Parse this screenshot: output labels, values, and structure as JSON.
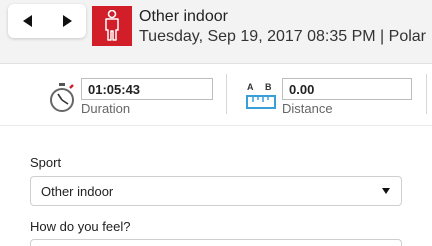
{
  "nav": {
    "prev_icon": "triangle-left-icon",
    "next_icon": "triangle-right-icon"
  },
  "header": {
    "title": "Other indoor",
    "subtitle": "Tuesday, Sep 19, 2017 08:35 PM | Polar",
    "sport_icon": "person-icon",
    "accent": "#d21e29"
  },
  "stats": {
    "duration": {
      "value": "01:05:43",
      "label": "Duration",
      "icon": "stopwatch-icon"
    },
    "distance": {
      "value": "0.00",
      "label": "Distance",
      "icon": "ruler-icon",
      "icon_text_a": "A",
      "icon_text_b": "B"
    }
  },
  "form": {
    "sport_label": "Sport",
    "sport_value": "Other indoor",
    "feel_label": "How do you feel?"
  },
  "colors": {
    "ruler": "#3a9ed8",
    "stopwatch_red": "#d21e29"
  }
}
